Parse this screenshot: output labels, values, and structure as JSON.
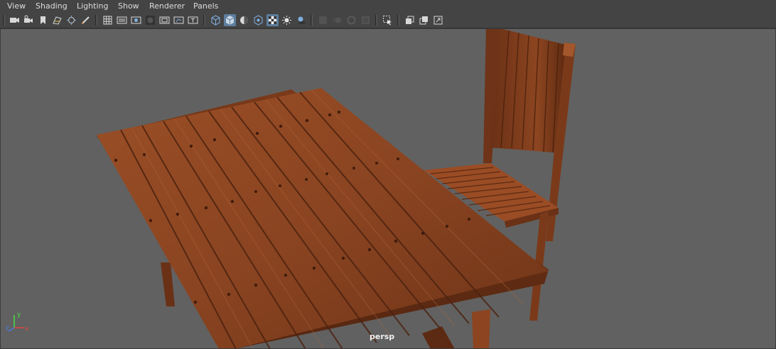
{
  "menu": [
    "View",
    "Shading",
    "Lighting",
    "Show",
    "Renderer",
    "Panels"
  ],
  "viewport": {
    "camera_label": "persp",
    "axis_labels": {
      "x": "x",
      "y": "y",
      "z": "z"
    }
  },
  "toolbar_icons": [
    "camera-icon",
    "camera-attributes-icon",
    "bookmark-icon",
    "image-plane-icon",
    "2d-pan-zoom-icon",
    "grease-pencil-icon",
    "grid-icon",
    "film-gate-icon",
    "resolution-gate-icon",
    "gate-mask-icon",
    "field-chart-icon",
    "safe-action-icon",
    "safe-title-icon",
    "wireframe-icon",
    "smooth-shade-icon",
    "default-material-icon",
    "isolate-select-icon",
    "textured-icon",
    "lighting-icon",
    "shadows-icon",
    "screen-space-ao-icon",
    "motion-blur-icon",
    "anti-aliasing-icon",
    "depth-of-field-icon",
    "xray-icon",
    "xray-joints-icon",
    "backface-culling-icon",
    "select-camera-icon",
    "single-view-icon",
    "two-views-icon",
    "expand-icon"
  ],
  "colors": {
    "menubar_bg": "#444444",
    "viewport_bg": "#616161",
    "active_button": "#5d7e9e",
    "wood_light": "#a0552c",
    "wood_dark": "#5c2a12"
  }
}
